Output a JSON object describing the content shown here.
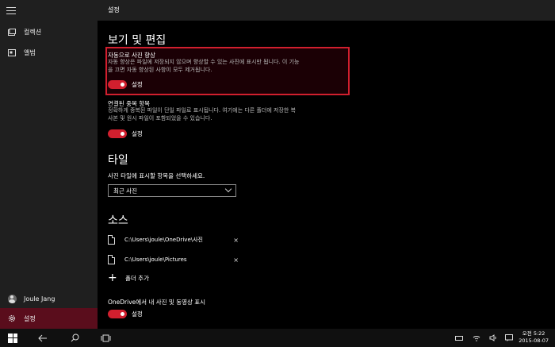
{
  "sidebar": {
    "menu_icon": "hamburger-icon",
    "items": [
      {
        "label": "컬렉션",
        "icon": "collection-icon"
      },
      {
        "label": "앨범",
        "icon": "album-icon"
      }
    ],
    "user": {
      "label": "Joule Jang",
      "icon": "avatar"
    },
    "settings": {
      "label": "설정",
      "icon": "gear-icon"
    }
  },
  "header": {
    "title": "설정"
  },
  "sections": {
    "view_edit": {
      "heading": "보기 및 편집",
      "auto_enhance": {
        "title": "자동으로 사진 향상",
        "desc_line1": "자동 향상은 파일에 저장되지 않으며 향상할 수 있는 사진에 표시만 됩니다. 이 기능",
        "desc_line2": "을 끄면 자동 향상된 사항이 모두 제거됩니다.",
        "toggle_label": "설정",
        "toggle_on": true
      },
      "linked_dupes": {
        "title": "연결된 중복 항목",
        "desc_line1": "정확하게 중복된 파일이 단일 파일로 표시됩니다. 여기에는 다른 폴더에 저장한 복",
        "desc_line2": "사본 및 원시 파일이 포함되었을 수 있습니다.",
        "toggle_label": "설정",
        "toggle_on": true
      }
    },
    "tile": {
      "heading": "타일",
      "prompt": "사진 타일에 표시할 항목을 선택하세요.",
      "dropdown_value": "최근 사진"
    },
    "source": {
      "heading": "소스",
      "folders": [
        {
          "path": "C:\\Users\\joule\\OneDrive\\사진",
          "remove": "×"
        },
        {
          "path": "C:\\Users\\joule\\Pictures",
          "remove": "×"
        }
      ],
      "add_label": "폴더 추가",
      "add_icon": "+"
    },
    "onedrive": {
      "title": "OneDrive에서 내 사진 및 동영상 표시",
      "toggle_label": "설정",
      "toggle_on": true
    }
  },
  "taskbar": {
    "time": "오전 5:22",
    "date": "2015-08-07"
  },
  "colors": {
    "accent": "#d11f2e",
    "sidebar_active": "#5a0d1c",
    "sidebar_bg": "#1f1f1f"
  }
}
